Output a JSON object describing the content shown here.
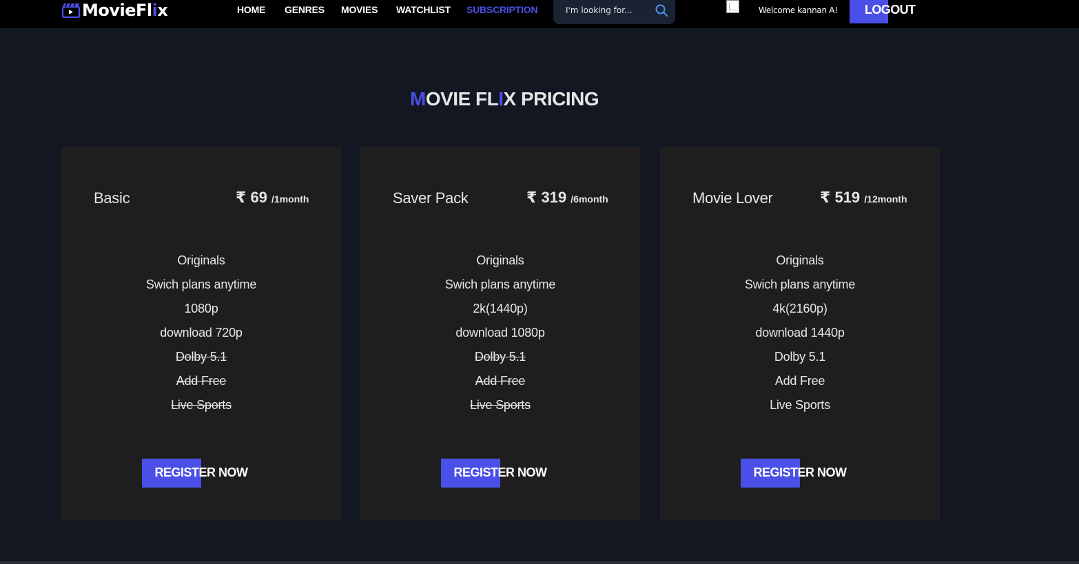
{
  "header": {
    "logo": {
      "text_main": "MovieFl",
      "text_accent": "i",
      "text_end": "x",
      "icon": "clapperboard-icon"
    },
    "nav": [
      {
        "label": "HOME",
        "active": false
      },
      {
        "label": "GENRES",
        "active": false
      },
      {
        "label": "MOVIES",
        "active": false
      },
      {
        "label": "WATCHLIST",
        "active": false
      },
      {
        "label": "SUBSCRIPTION",
        "active": true
      }
    ],
    "search": {
      "placeholder": "I'm looking for...",
      "icon": "search-icon"
    },
    "welcome": "Welcome kannan A!",
    "logout_label": "LOGOUT"
  },
  "pricing": {
    "title_first": "M",
    "title_mid": "OVIE FL",
    "title_accent": "I",
    "title_end": "X PRICING",
    "plans": [
      {
        "name": "Basic",
        "currency": "₹",
        "amount": "69",
        "period": "/1month",
        "features": [
          {
            "text": "Originals",
            "included": true
          },
          {
            "text": "Swich plans anytime",
            "included": true
          },
          {
            "text": "1080p",
            "included": true
          },
          {
            "text": "download 720p",
            "included": true
          },
          {
            "text": "Dolby 5.1",
            "included": false
          },
          {
            "text": "Add Free",
            "included": false
          },
          {
            "text": "Live Sports",
            "included": false
          }
        ],
        "button": "REGISTER NOW"
      },
      {
        "name": "Saver Pack",
        "currency": "₹",
        "amount": "319",
        "period": "/6month",
        "features": [
          {
            "text": "Originals",
            "included": true
          },
          {
            "text": "Swich plans anytime",
            "included": true
          },
          {
            "text": "2k(1440p)",
            "included": true
          },
          {
            "text": "download 1080p",
            "included": true
          },
          {
            "text": "Dolby 5.1",
            "included": false
          },
          {
            "text": "Add Free",
            "included": false
          },
          {
            "text": "Live Sports",
            "included": false
          }
        ],
        "button": "REGISTER NOW"
      },
      {
        "name": "Movie Lover",
        "currency": "₹",
        "amount": "519",
        "period": "/12month",
        "features": [
          {
            "text": "Originals",
            "included": true
          },
          {
            "text": "Swich plans anytime",
            "included": true
          },
          {
            "text": "4k(2160p)",
            "included": true
          },
          {
            "text": "download 1440p",
            "included": true
          },
          {
            "text": "Dolby 5.1",
            "included": true
          },
          {
            "text": "Add Free",
            "included": true
          },
          {
            "text": "Live Sports",
            "included": true
          }
        ],
        "button": "REGISTER NOW"
      }
    ]
  },
  "colors": {
    "accent": "#4a4fe8",
    "background": "#121722",
    "card": "#1f1e1e",
    "header": "#000000"
  }
}
